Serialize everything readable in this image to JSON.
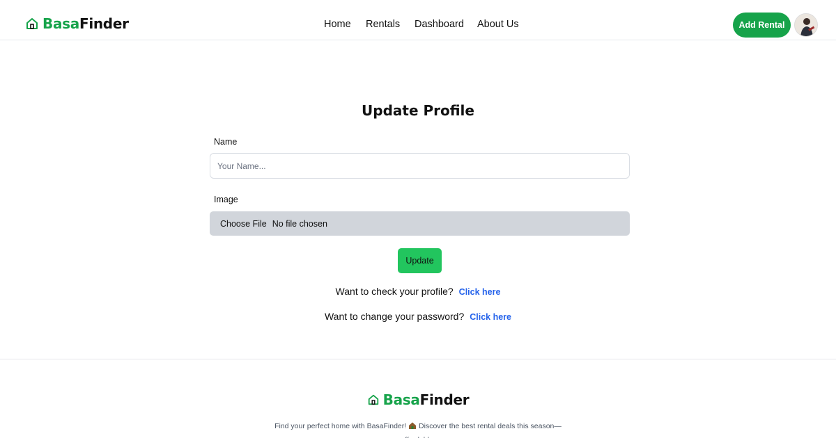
{
  "brand": {
    "part1": "Basa",
    "part2": "Finder",
    "accent": "#16a34a"
  },
  "nav": {
    "items": [
      "Home",
      "Rentals",
      "Dashboard",
      "About Us"
    ]
  },
  "header": {
    "add_rental_label": "Add Rental",
    "avatar_icon": "user-avatar"
  },
  "form": {
    "title": "Update Profile",
    "name_label": "Name",
    "name_placeholder": "Your Name...",
    "name_value": "",
    "image_label": "Image",
    "file_button_label": "Choose File",
    "file_status": "No file chosen",
    "update_label": "Update",
    "profile_prompt": "Want to check your profile?",
    "profile_link": "Click here",
    "password_prompt": "Want to change your password?",
    "password_link": "Click here"
  },
  "footer": {
    "brand_part1": "Basa",
    "brand_part2": "Finder",
    "text_before_emoji": "Find your perfect home with BasaFinder!",
    "text_after_emoji": "Discover the best rental deals this season—affordable,",
    "emoji_icon": "house-emoji"
  },
  "colors": {
    "primary_green": "#16a34a",
    "button_green": "#22c55e",
    "link_blue": "#2563eb"
  }
}
